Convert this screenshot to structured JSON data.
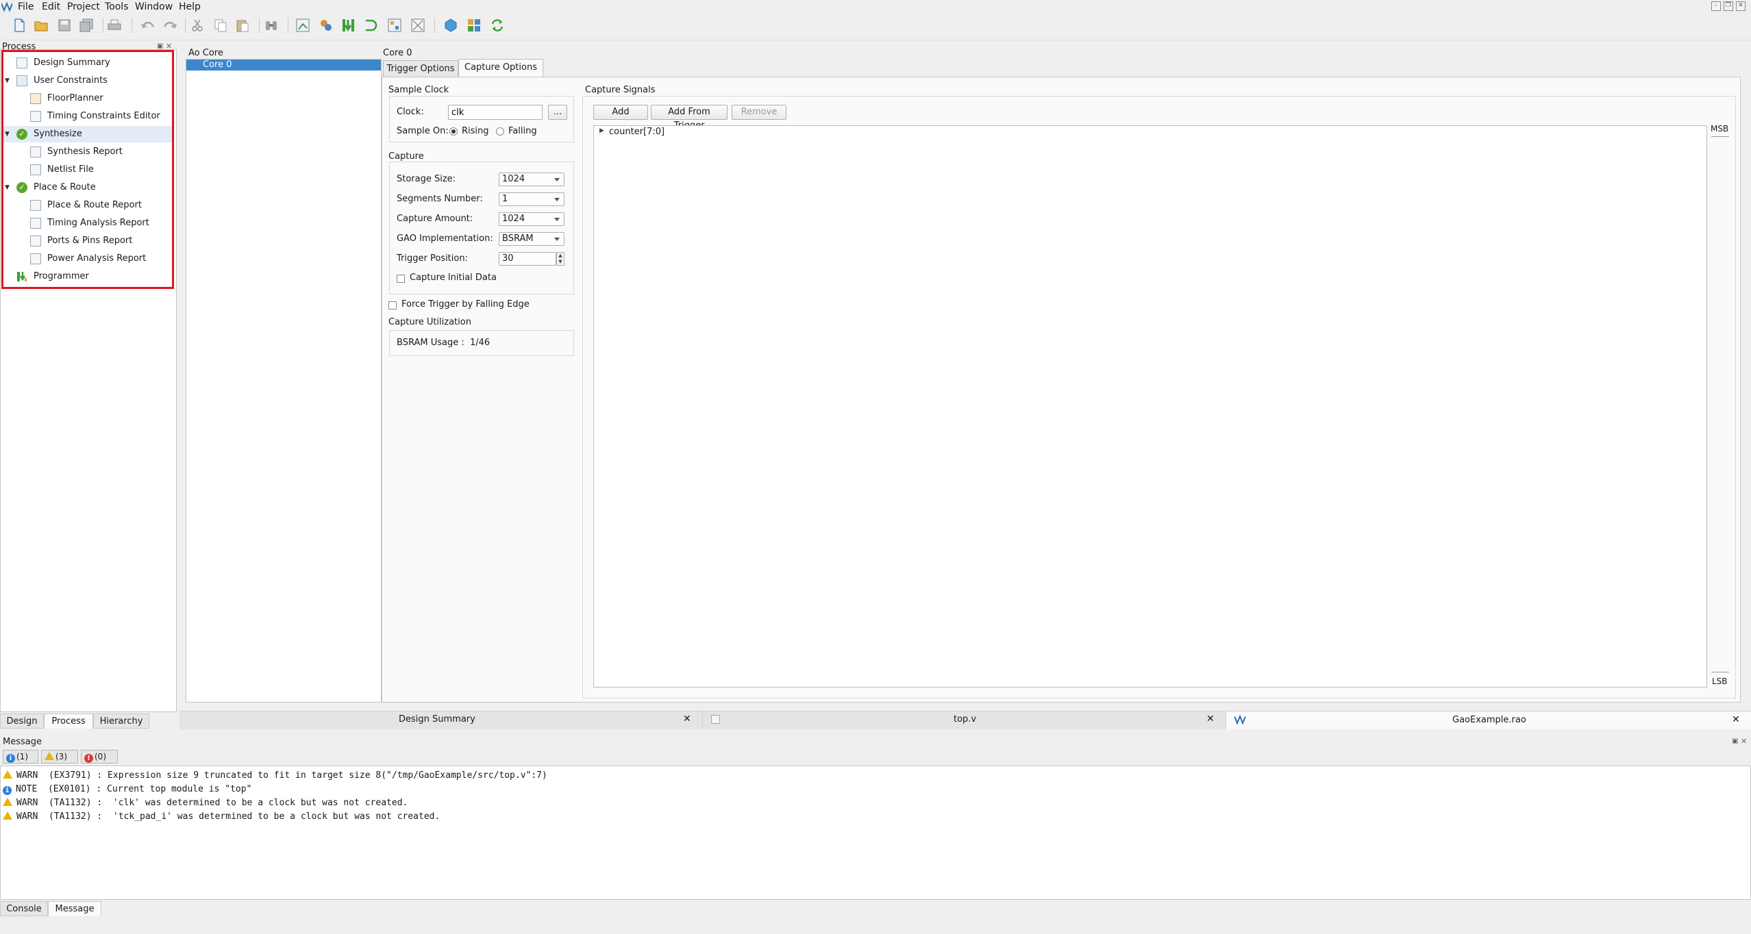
{
  "menubar": {
    "items": [
      "File",
      "Edit",
      "Project",
      "Tools",
      "Window",
      "Help"
    ]
  },
  "toolbar": {
    "icons": [
      "new-file-icon",
      "open-folder-icon",
      "save-icon",
      "save-all-icon",
      "print-icon",
      "undo-icon",
      "redo-icon",
      "cut-icon",
      "copy-icon",
      "paste-icon",
      "find-icon",
      "floorplanner-tool-icon",
      "gao-icon",
      "program-device-icon",
      "timing-tool-icon",
      "schematic-icon",
      "constraints-icon",
      "ip-core-icon",
      "resource-grid-icon",
      "refresh-icon"
    ]
  },
  "process_panel": {
    "title": "Process",
    "items": [
      {
        "label": "Design Summary",
        "icon": "document-icon",
        "level": 0,
        "expanded": null
      },
      {
        "label": "User Constraints",
        "icon": "constraints-icon",
        "level": 0,
        "expanded": true
      },
      {
        "label": "FloorPlanner",
        "icon": "floorplanner-icon",
        "level": 1,
        "expanded": null
      },
      {
        "label": "Timing Constraints Editor",
        "icon": "timing-editor-icon",
        "level": 1,
        "expanded": null
      },
      {
        "label": "Synthesize",
        "icon": "check-icon",
        "level": 0,
        "expanded": true
      },
      {
        "label": "Synthesis Report",
        "icon": "report-icon",
        "level": 1,
        "expanded": null
      },
      {
        "label": "Netlist File",
        "icon": "report-icon",
        "level": 1,
        "expanded": null
      },
      {
        "label": "Place & Route",
        "icon": "check-icon",
        "level": 0,
        "expanded": true
      },
      {
        "label": "Place & Route Report",
        "icon": "report-icon",
        "level": 1,
        "expanded": null
      },
      {
        "label": "Timing Analysis Report",
        "icon": "report-icon",
        "level": 1,
        "expanded": null
      },
      {
        "label": "Ports & Pins Report",
        "icon": "report-icon",
        "level": 1,
        "expanded": null
      },
      {
        "label": "Power Analysis Report",
        "icon": "report-icon",
        "level": 1,
        "expanded": null
      },
      {
        "label": "Programmer",
        "icon": "programmer-icon",
        "level": 0,
        "expanded": null
      }
    ],
    "tabs": [
      "Design",
      "Process",
      "Hierarchy"
    ],
    "active_tab": "Process"
  },
  "ao_core": {
    "header": "Ao Core",
    "items": [
      "Core 0"
    ]
  },
  "core": {
    "header": "Core 0",
    "tabs": [
      "Trigger Options",
      "Capture Options"
    ],
    "active_tab": "Capture Options",
    "sample_clock": {
      "title": "Sample Clock",
      "clock_label": "Clock:",
      "clock_value": "clk",
      "browse_label": "...",
      "sample_on_label": "Sample On:",
      "rising_label": "Rising",
      "falling_label": "Falling",
      "selected": "Rising"
    },
    "capture": {
      "title": "Capture",
      "storage_size_label": "Storage Size:",
      "storage_size": "1024",
      "segments_label": "Segments Number:",
      "segments": "1",
      "capture_amount_label": "Capture Amount:",
      "capture_amount": "1024",
      "gao_impl_label": "GAO Implementation:",
      "gao_impl": "BSRAM",
      "trigger_pos_label": "Trigger Position:",
      "trigger_pos": "30",
      "capture_initial_label": "Capture Initial Data",
      "capture_initial_checked": false
    },
    "force_trigger_label": "Force Trigger by Falling Edge",
    "force_trigger_checked": false,
    "utilization": {
      "title": "Capture Utilization",
      "text": "BSRAM Usage :  1/46"
    },
    "capture_signals": {
      "title": "Capture Signals",
      "add_label": "Add",
      "add_from_trigger_label": "Add From Trigger",
      "remove_label": "Remove",
      "signals": [
        "counter[7:0]"
      ],
      "msb_label": "MSB",
      "lsb_label": "LSB"
    }
  },
  "editor_tabs": [
    {
      "label": "Design Summary"
    },
    {
      "label": "top.v"
    },
    {
      "label": "GaoExample.rao"
    }
  ],
  "message_panel": {
    "title": "Message",
    "filters": [
      {
        "icon": "info-icon",
        "count": "(1)"
      },
      {
        "icon": "warning-icon",
        "count": "(3)"
      },
      {
        "icon": "error-icon",
        "count": "(0)"
      }
    ],
    "messages": [
      {
        "level": "WARN",
        "text": "WARN  (EX3791) : Expression size 9 truncated to fit in target size 8(\"/tmp/GaoExample/src/top.v\":7)"
      },
      {
        "level": "NOTE",
        "text": "NOTE  (EX0101) : Current top module is \"top\""
      },
      {
        "level": "WARN",
        "text": "WARN  (TA1132) :  'clk' was determined to be a clock but was not created."
      },
      {
        "level": "WARN",
        "text": "WARN  (TA1132) :  'tck_pad_i' was determined to be a clock but was not created."
      }
    ],
    "tabs": [
      "Console",
      "Message"
    ],
    "active_tab": "Message"
  },
  "colors": {
    "selection": "#3c87cc",
    "highlight_box": "#e0141e",
    "ok_green": "#5aa62a",
    "warn": "#e8b30a",
    "note": "#2f7ed8",
    "error": "#d83a3a"
  }
}
